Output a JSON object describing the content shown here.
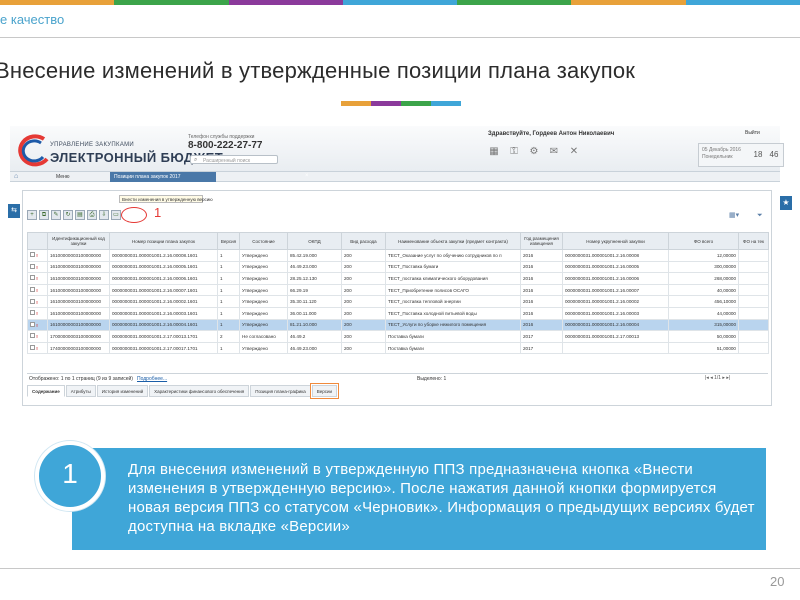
{
  "slide": {
    "brand": "е качество",
    "title": "Внесение изменений в утвержденные позиции плана закупок",
    "page_number": "20",
    "stripe_colors": [
      "#e8a13a",
      "#3ca44a",
      "#8b3a9b",
      "#3fa6d8",
      "#3ca44a",
      "#e8a13a",
      "#3fa6d8"
    ],
    "deco_colors": [
      "#e8a13a",
      "#8b3a9b",
      "#3ca44a",
      "#3fa6d8"
    ]
  },
  "app": {
    "logo_top": "УПРАВЛЕНИЕ ЗАКУПКАМИ",
    "logo_main": "ЭЛЕКТРОННЫЙ БЮДЖЕТ",
    "support_label": "Телефон службы поддержки",
    "support_phone": "8-800-222-27-77",
    "search_placeholder": "Расширенный поиск",
    "greeting": "Здравствуйте, Гордеев Антон Николаевич",
    "exit_label": "Выйти",
    "date_line1": "05 Декабрь 2016",
    "date_line2": "Понедельник",
    "time_hours": "18",
    "time_minutes": "46",
    "menu_label": "Меню",
    "open_tab": "Позиции плана закупок 2017",
    "tooltip": "Внести изменения в утвержденную версию",
    "callout_marker": "1",
    "icons": [
      "home-icon",
      "search-icon",
      "grid-icon",
      "key-icon",
      "settings-icon",
      "mail-icon",
      "close-icon",
      "refresh-icon",
      "filter-icon"
    ]
  },
  "grid": {
    "columns": [
      "",
      "Идентификационный код закупки",
      "Номер позиции плана закупок",
      "Версия",
      "Состояние",
      "ОКПД",
      "Вид расхода",
      "Наименование объекта закупки (предмет контракта)",
      "Год размещения извещения",
      "Номер укрупненной закупки",
      "ФО всего",
      "ФО на тек"
    ],
    "rows": [
      {
        "ikz": "16100000003100000000",
        "num": "0000000031.000001001.2.16.00008.1601",
        "ver": "1",
        "state": "Утверждено",
        "okpd": "85.42.19.000",
        "vr": "200",
        "name": "ТЕСТ_Оказание услуг по обучению сотрудников по п",
        "year": "2016",
        "uz": "0000000031.000001001.2.16.00008",
        "fo": "12,00000",
        "sel": false
      },
      {
        "ikz": "16100000003100000000",
        "num": "0000000031.000001001.2.16.00005.1601",
        "ver": "1",
        "state": "Утверждено",
        "okpd": "46.49.23.000",
        "vr": "200",
        "name": "ТЕСТ_Поставка бумаги",
        "year": "2016",
        "uz": "0000000031.000001001.2.16.00005",
        "fo": "300,00000",
        "sel": false
      },
      {
        "ikz": "16100000003100000000",
        "num": "0000000031.000001001.2.16.00006.1601",
        "ver": "1",
        "state": "Утверждено",
        "okpd": "28.25.12.130",
        "vr": "200",
        "name": "ТЕСТ_поставка климатического оборудования",
        "year": "2016",
        "uz": "0000000031.000001001.2.16.00006",
        "fo": "268,00000",
        "sel": false
      },
      {
        "ikz": "16100000003100000000",
        "num": "0000000031.000001001.2.16.00007.1601",
        "ver": "1",
        "state": "Утверждено",
        "okpd": "66.29.19",
        "vr": "200",
        "name": "ТЕСТ_Приобретение полисов ОСАГО",
        "year": "2016",
        "uz": "0000000031.000001001.2.16.00007",
        "fo": "40,00000",
        "sel": false
      },
      {
        "ikz": "16100000003100000000",
        "num": "0000000031.000001001.2.16.00002.1601",
        "ver": "1",
        "state": "Утверждено",
        "okpd": "35.30.11.120",
        "vr": "200",
        "name": "ТЕСТ_поставка тепловой энергии",
        "year": "2016",
        "uz": "0000000031.000001001.2.16.00002",
        "fo": "456,10000",
        "sel": false
      },
      {
        "ikz": "16100000003100000000",
        "num": "0000000031.000001001.2.16.00003.1601",
        "ver": "1",
        "state": "Утверждено",
        "okpd": "36.00.11.000",
        "vr": "200",
        "name": "ТЕСТ_Поставка холодной питьевой воды",
        "year": "2016",
        "uz": "0000000031.000001001.2.16.00003",
        "fo": "44,00000",
        "sel": false
      },
      {
        "ikz": "16100000003100000000",
        "num": "0000000031.000001001.2.16.00004.1601",
        "ver": "1",
        "state": "Утверждено",
        "okpd": "81.21.10.000",
        "vr": "200",
        "name": "ТЕСТ_Услуги по уборке нежилого помещения",
        "year": "2016",
        "uz": "0000000031.000001001.2.16.00004",
        "fo": "315,00000",
        "sel": true
      },
      {
        "ikz": "17000000003100000000",
        "num": "0000000031.000001001.2.17.00013.1701",
        "ver": "2",
        "state": "Не согласовано",
        "okpd": "46.49.2",
        "vr": "200",
        "name": "Поставка бумаги",
        "year": "2017",
        "uz": "0000000031.000001001.2.17.00013",
        "fo": "50,00000",
        "sel": false
      },
      {
        "ikz": "17400000003100000000",
        "num": "0000000031.000001001.2.17.00017.1701",
        "ver": "1",
        "state": "Утверждено",
        "okpd": "46.49.23.000",
        "vr": "200",
        "name": "Поставка бумаги",
        "year": "2017",
        "uz": "",
        "fo": "51,00000",
        "sel": false
      }
    ]
  },
  "pager": {
    "shown": "Отображено: 1 по 1 страниц (9 из 9 записей)",
    "more": "Подробнее...",
    "selected": "Выделено: 1",
    "nav": "|◂  ◂   1/1   ▸  ▸|"
  },
  "bottom_tabs": [
    {
      "label": "Содержание",
      "active": true,
      "hl": false
    },
    {
      "label": "Атрибуты",
      "active": false,
      "hl": false
    },
    {
      "label": "История изменений",
      "active": false,
      "hl": false
    },
    {
      "label": "Характеристики финансового обеспечения",
      "active": false,
      "hl": false
    },
    {
      "label": "Позиция плана-графика",
      "active": false,
      "hl": false
    },
    {
      "label": "Версии",
      "active": false,
      "hl": true
    }
  ],
  "callout": {
    "number": "1",
    "text": "Для внесения изменений в утвержденную ППЗ предназначена кнопка «Внести изменения в утвержденную версию». После нажатия данной кнопки формируется новая версия ППЗ со статусом «Черновик». Информация о  предыдущих версиях будет доступна на вкладке «Версии»"
  }
}
